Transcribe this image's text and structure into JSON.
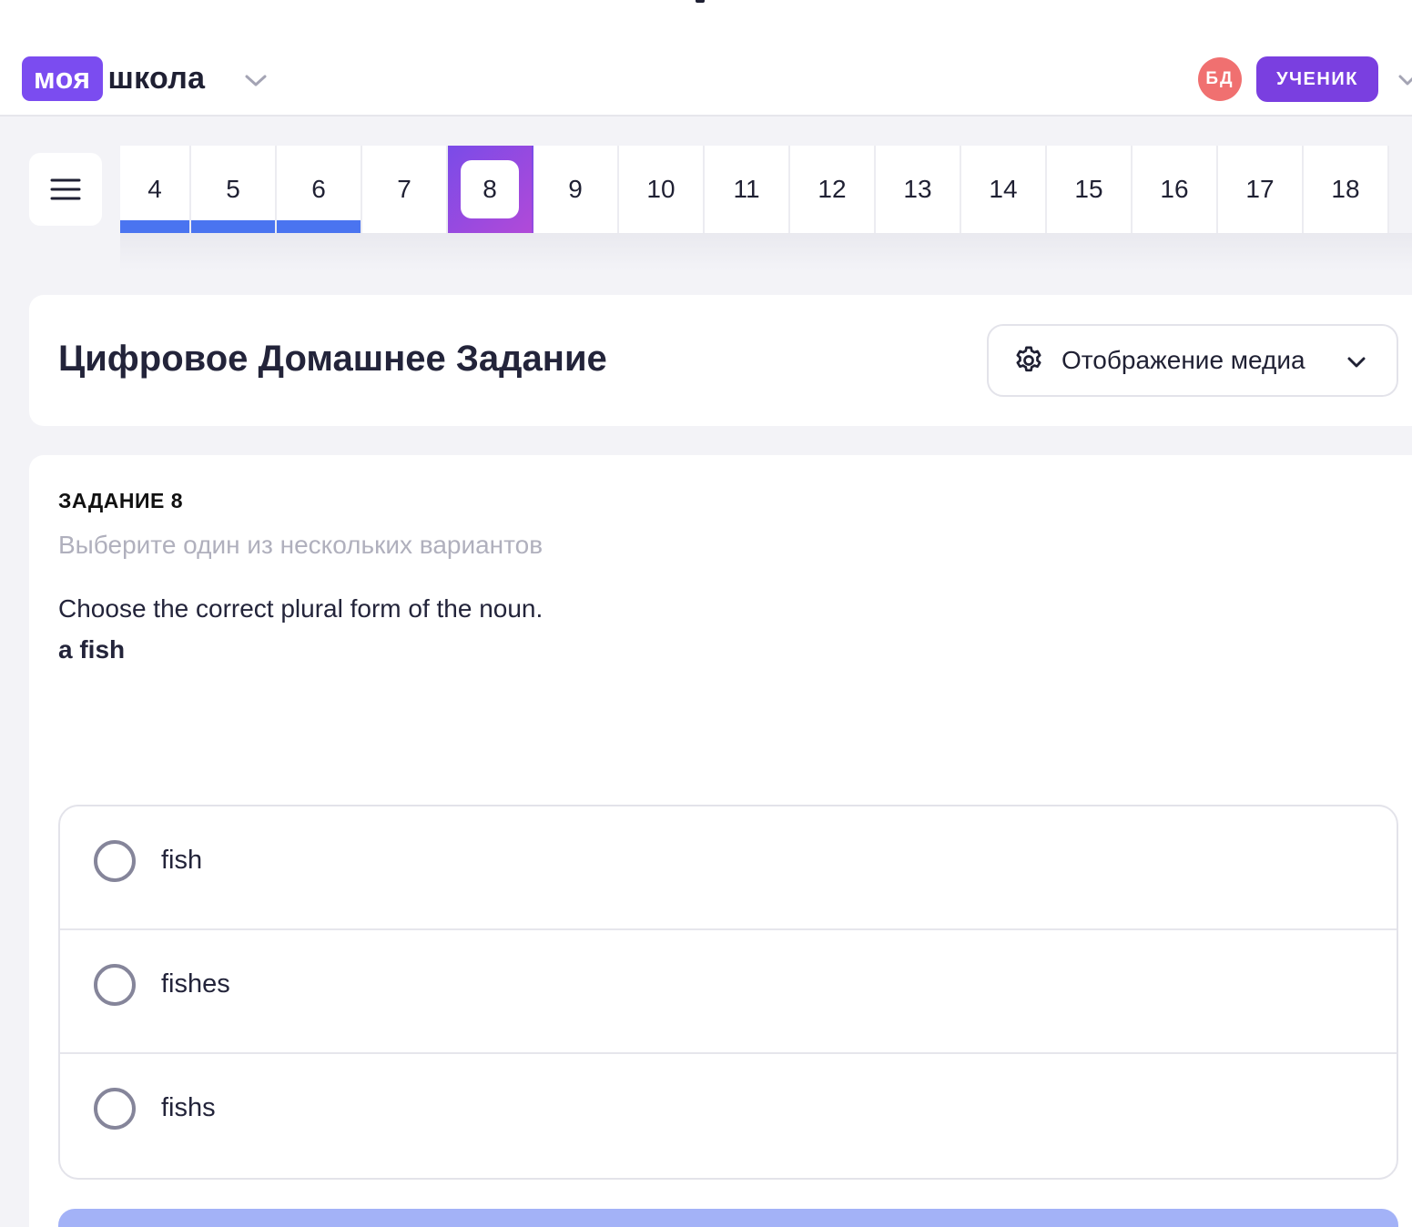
{
  "header": {
    "logo_badge": "моя",
    "logo_text": "школа",
    "avatar_initials": "БД",
    "role_label": "УЧЕНИК"
  },
  "task_strip": {
    "items": [
      {
        "label": "4",
        "status": "done"
      },
      {
        "label": "5",
        "status": "done"
      },
      {
        "label": "6",
        "status": "done"
      },
      {
        "label": "7",
        "status": "pending"
      },
      {
        "label": "8",
        "status": "current"
      },
      {
        "label": "9",
        "status": "pending"
      },
      {
        "label": "10",
        "status": "pending"
      },
      {
        "label": "11",
        "status": "pending"
      },
      {
        "label": "12",
        "status": "pending"
      },
      {
        "label": "13",
        "status": "pending"
      },
      {
        "label": "14",
        "status": "pending"
      },
      {
        "label": "15",
        "status": "pending"
      },
      {
        "label": "16",
        "status": "pending"
      },
      {
        "label": "17",
        "status": "pending"
      },
      {
        "label": "18",
        "status": "pending"
      }
    ]
  },
  "title_card": {
    "title": "Цифровое Домашнее Задание",
    "media_button_label": "Отображение медиа"
  },
  "task": {
    "number_label": "ЗАДАНИЕ 8",
    "hint": "Выберите один из нескольких вариантов",
    "question": "Choose the correct plural form of the noun.",
    "word": "a fish",
    "options": [
      {
        "label": "fish",
        "selected": false
      },
      {
        "label": "fishes",
        "selected": false
      },
      {
        "label": "fishs",
        "selected": false
      }
    ]
  },
  "colors": {
    "brand": "#7b4cf0",
    "role_badge": "#7a3fe0",
    "avatar": "#f07070",
    "done_bar": "#4a74f0",
    "submit": "#a3b2f7"
  }
}
